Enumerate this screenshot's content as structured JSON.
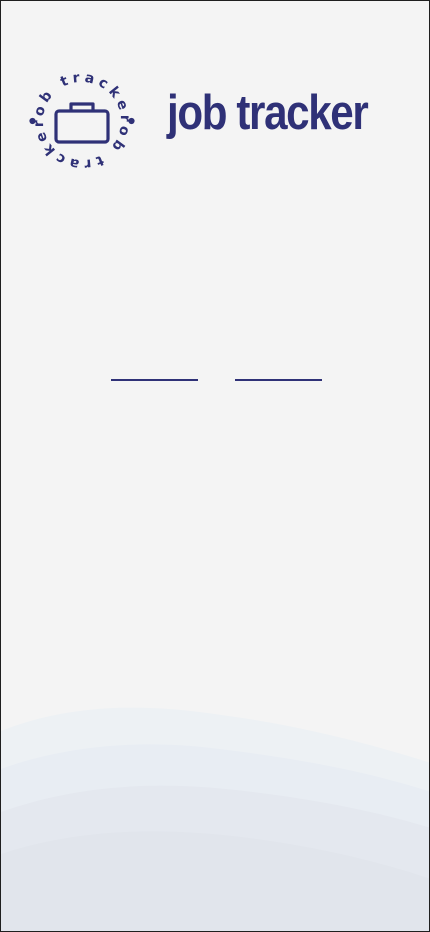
{
  "app": {
    "logo_text": "job tracker",
    "wordmark": "job tracker"
  },
  "colors": {
    "brand": "#2f3177",
    "background": "#f4f4f4",
    "wave_1": "#edf1f4",
    "wave_2": "#e8edf3",
    "wave_3": "#e4e8ef",
    "wave_4": "#e1e5ec"
  },
  "icons": {
    "logo": "briefcase-icon"
  }
}
